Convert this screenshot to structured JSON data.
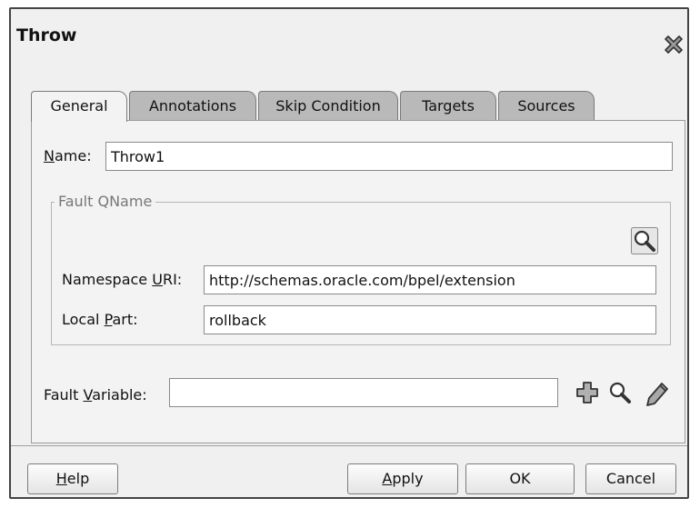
{
  "dialog": {
    "title": "Throw"
  },
  "tabs": [
    {
      "label": "General",
      "active": true
    },
    {
      "label": "Annotations"
    },
    {
      "label": "Skip Condition"
    },
    {
      "label": "Targets"
    },
    {
      "label": "Sources"
    }
  ],
  "general": {
    "name_label_u": "N",
    "name_label_rest": "ame:",
    "name_value": "Throw1",
    "group_legend": "Fault QName",
    "namespace_label_pre": "Namespace ",
    "namespace_label_u": "U",
    "namespace_label_rest": "RI:",
    "namespace_value": "http://schemas.oracle.com/bpel/extension",
    "local_label_pre": "Local ",
    "local_label_u": "P",
    "local_label_rest": "art:",
    "local_value": "rollback",
    "fault_var_label_pre": "Fault ",
    "fault_var_label_u": "V",
    "fault_var_label_rest": "ariable:",
    "fault_var_value": ""
  },
  "buttons": {
    "help_u": "H",
    "help_rest": "elp",
    "apply_u": "A",
    "apply_rest": "pply",
    "ok": "OK",
    "cancel": "Cancel"
  },
  "icons": {
    "close": "close-x-icon",
    "browse": "magnifier-icon",
    "add": "plus-icon",
    "edit": "pencil-icon"
  }
}
